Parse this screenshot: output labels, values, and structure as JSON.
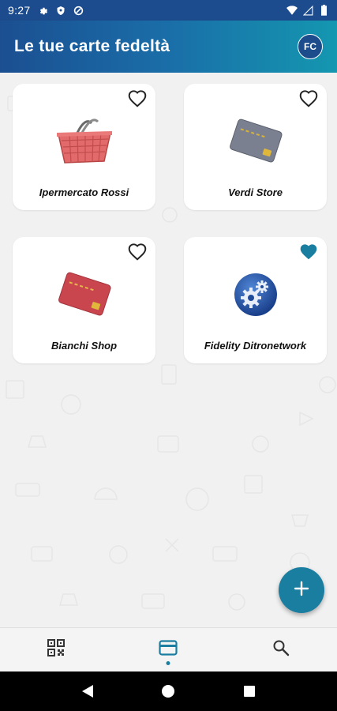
{
  "status_bar": {
    "time": "9:27",
    "left_icons": [
      "settings-icon",
      "shield-icon",
      "data-saver-icon"
    ],
    "right_icons": [
      "wifi-icon",
      "signal-icon",
      "battery-icon"
    ]
  },
  "app_bar": {
    "title": "Le tue carte fedeltà",
    "avatar_initials": "FC"
  },
  "cards": [
    {
      "name": "Ipermercato Rossi",
      "image": "shopping-basket-icon",
      "favorite": false
    },
    {
      "name": "Verdi Store",
      "image": "gray-card-icon",
      "favorite": false
    },
    {
      "name": "Bianchi Shop",
      "image": "red-card-icon",
      "favorite": false
    },
    {
      "name": "Fidelity Ditronetwork",
      "image": "gears-logo-icon",
      "favorite": true
    }
  ],
  "fab": {
    "icon": "plus-icon"
  },
  "bottom_nav": {
    "items": [
      {
        "icon": "qr-code-icon",
        "active": false
      },
      {
        "icon": "card-icon",
        "active": true
      },
      {
        "icon": "search-icon",
        "active": false
      }
    ]
  },
  "system_nav": [
    "back-icon",
    "home-icon",
    "recents-icon"
  ],
  "colors": {
    "accent": "#1a7ea0",
    "status_bar": "#1d4c8e",
    "app_bar_start": "#1b4f92",
    "app_bar_end": "#1497b0",
    "background": "#f1f1f1"
  }
}
